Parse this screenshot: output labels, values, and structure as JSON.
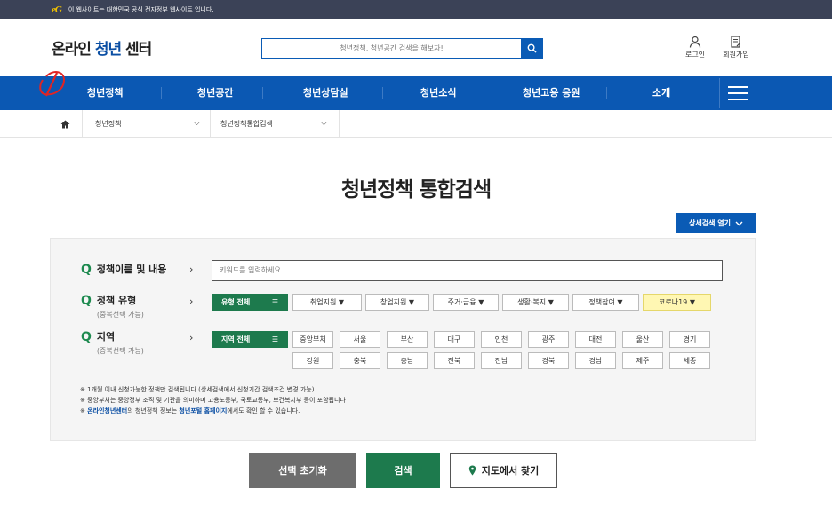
{
  "gov_bar": {
    "mark": "eG",
    "text": "이 웹사이트는 대한민국 공식 전자정부 웹사이트 입니다."
  },
  "logo": {
    "prefix": "온라인 ",
    "accent": "청년",
    "suffix": " 센터"
  },
  "search": {
    "placeholder": "청년정책, 청년공간 검색을 해보자!"
  },
  "utils": {
    "login": "로그인",
    "signup": "회원가입"
  },
  "nav": [
    "청년정책",
    "청년공간",
    "청년상담실",
    "청년소식",
    "청년고용 응원",
    "소개"
  ],
  "breadcrumb": {
    "level1": "청년정책",
    "level2": "청년정책통합검색"
  },
  "page_title": "청년정책 통합검색",
  "detail_button": "상세검색 열기",
  "form": {
    "keyword": {
      "label": "정책이름 및 내용",
      "placeholder": "키워드를 입력하세요"
    },
    "type": {
      "label": "정책 유형",
      "sub": "(중복선택 가능)",
      "all": "유형 전체",
      "options": [
        "취업지원",
        "창업지원",
        "주거·금융",
        "생활·복지",
        "정책참여",
        "코로나19"
      ]
    },
    "region": {
      "label": "지역",
      "sub": "(중복선택 가능)",
      "all": "지역 전체",
      "row1": [
        "중앙부처",
        "서울",
        "부산",
        "대구",
        "인천",
        "광주",
        "대전",
        "울산",
        "경기"
      ],
      "row2": [
        "강원",
        "충북",
        "충남",
        "전북",
        "전남",
        "경북",
        "경남",
        "제주",
        "세종"
      ]
    }
  },
  "notes": {
    "line1": "※ 1개월 이내 신청가능한 정책만 검색됩니다.(상세검색에서 신청기간 검색조건 변경 가능)",
    "line2": "※ 중앙부처는 중앙정부 조직 및 기관을 의미하며 고용노동부, 국토교통부, 보건복지부 등이 포함됩니다",
    "line3_prefix": "※ ",
    "line3_link1": "온라인청년센터",
    "line3_mid": "의 청년정책 정보는 ",
    "line3_link2": "청년포털 홈페이지",
    "line3_suffix": "에서도 확인 할 수 있습니다."
  },
  "buttons": {
    "reset": "선택 초기화",
    "search": "검색",
    "map": "지도에서 찾기"
  },
  "colors": {
    "nav": "#0b58b3",
    "green": "#1d7a4d",
    "covid_chip": "#fff7b3"
  }
}
